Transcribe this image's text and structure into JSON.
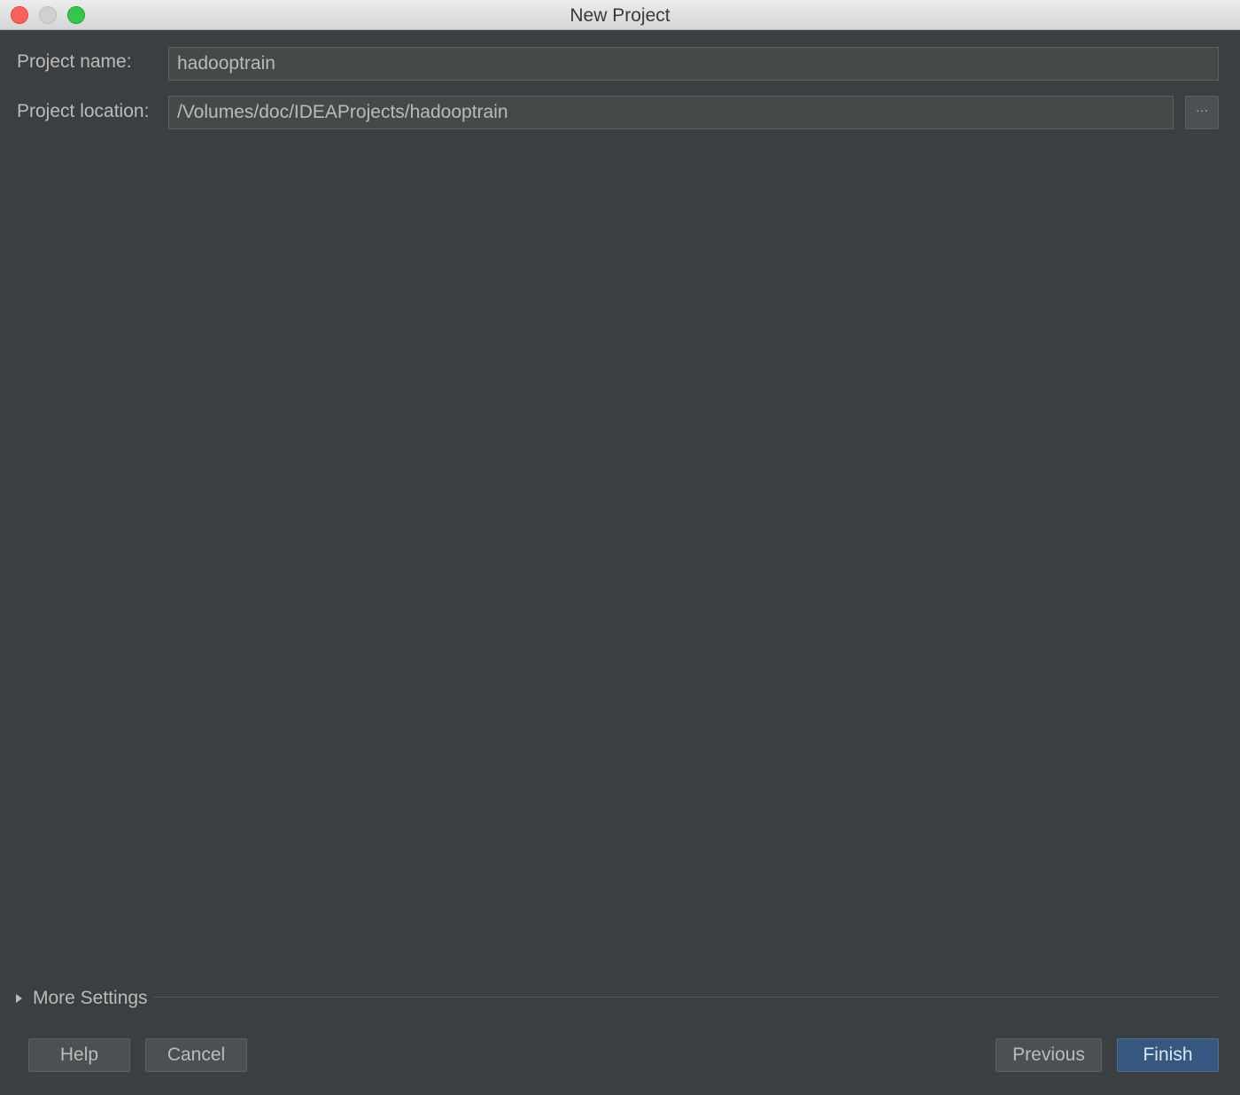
{
  "window": {
    "title": "New Project"
  },
  "form": {
    "project_name_label": "Project name:",
    "project_name_value": "hadooptrain",
    "project_location_label": "Project location:",
    "project_location_value": "/Volumes/doc/IDEAProjects/hadooptrain",
    "browse_label": "···"
  },
  "more_settings": {
    "label": "More Settings"
  },
  "buttons": {
    "help": "Help",
    "cancel": "Cancel",
    "previous": "Previous",
    "finish": "Finish"
  },
  "colors": {
    "background": "#3c3f41",
    "field_background": "#45494a",
    "text": "#bbbbbb",
    "primary_button": "#365880"
  },
  "icons": {
    "close": "close-icon",
    "minimize": "minimize-icon",
    "zoom": "zoom-icon",
    "expand": "triangle-right-icon"
  }
}
